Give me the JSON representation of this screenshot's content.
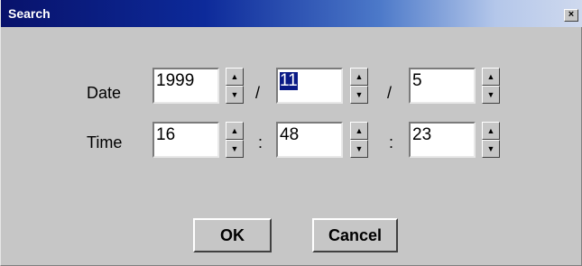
{
  "window": {
    "title": "Search",
    "close_glyph": "×"
  },
  "date": {
    "label": "Date",
    "year": "1999",
    "month": "11",
    "day": "5",
    "separator": "/"
  },
  "time": {
    "label": "Time",
    "hour": "16",
    "minute": "48",
    "second": "23",
    "separator": ":"
  },
  "spinner": {
    "up_glyph": "▲",
    "down_glyph": "▼"
  },
  "buttons": {
    "ok_label": "OK",
    "cancel_label": "Cancel"
  },
  "icons": {
    "close": "close-icon",
    "spin_up": "spin-up-icon",
    "spin_down": "spin-down-icon"
  }
}
